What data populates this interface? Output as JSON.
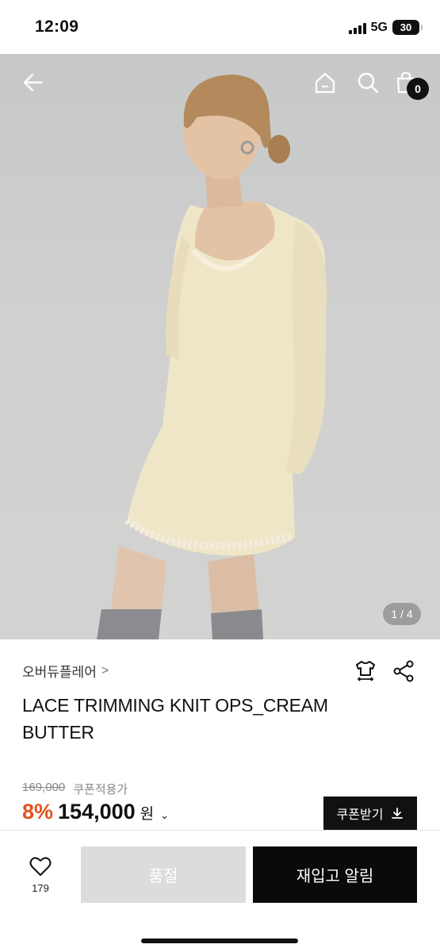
{
  "status_bar": {
    "time": "12:09",
    "network": "5G",
    "battery": "30"
  },
  "hero": {
    "back_icon": "arrow-left-icon",
    "home_icon": "home-icon",
    "search_icon": "search-icon",
    "cart_icon": "shopping-bag-icon",
    "cart_count": "0",
    "pager": "1 / 4"
  },
  "product": {
    "brand": "오버듀플레어",
    "brand_chevron": ">",
    "title": "LACE TRIMMING KNIT OPS_CREAM BUTTER",
    "original_price": "169,000",
    "coupon_price_label": "쿠폰적용가",
    "discount": "8%",
    "sale_price": "154,000",
    "currency": "원",
    "currency_chevron": "⌄",
    "coupon_button": "쿠폰받기"
  },
  "bottom_bar": {
    "like_count": "179",
    "soldout_label": "품절",
    "restock_label": "재입고 알림"
  },
  "colors": {
    "discount": "#e2531d",
    "dark": "#111111",
    "disabled": "#dcdcdc"
  }
}
